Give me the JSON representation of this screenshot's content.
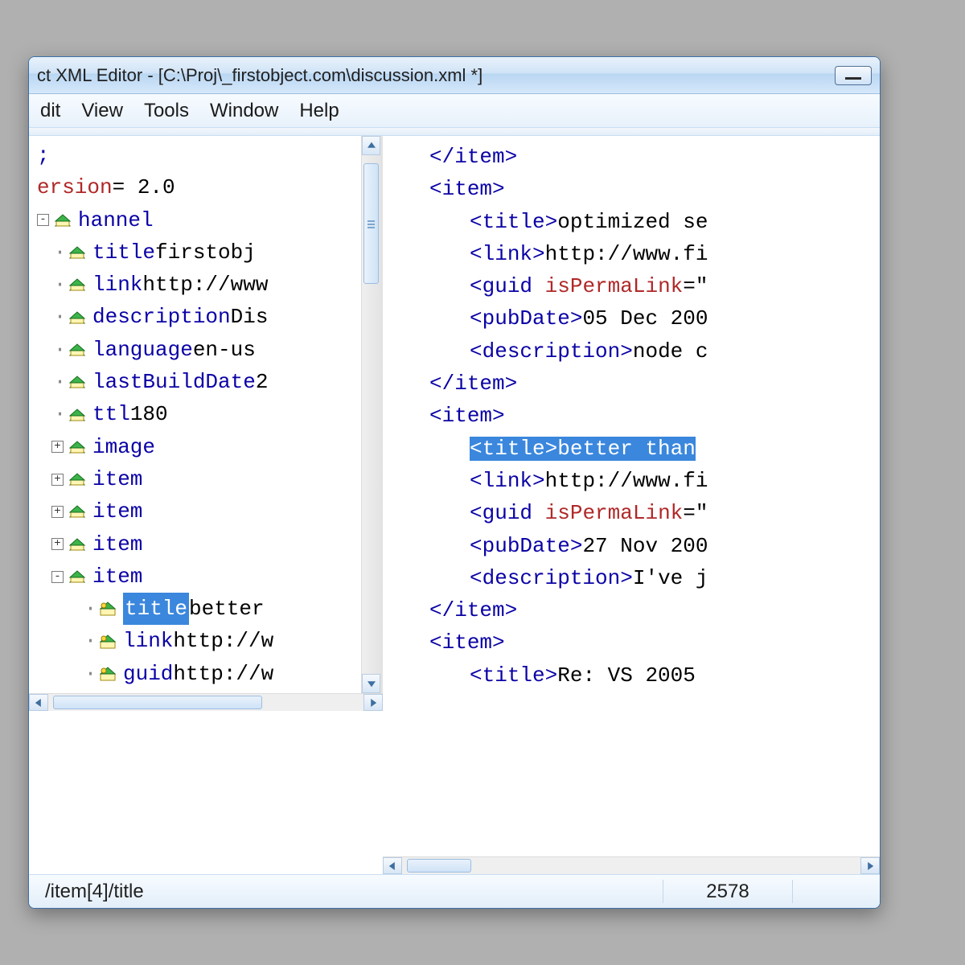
{
  "window": {
    "title_prefix": "ct XML Editor - [",
    "title_path": "C:\\Proj\\_firstobject.com\\discussion.xml *",
    "title_suffix": "]"
  },
  "menubar": [
    "dit",
    "View",
    "Tools",
    "Window",
    "Help"
  ],
  "tree": [
    {
      "indent": 1,
      "plus": "",
      "icon": "",
      "name": "",
      "value": "",
      "selected": false,
      "raw": ";"
    },
    {
      "indent": 1,
      "plus": "",
      "icon": "",
      "name": "ersion",
      "value": "= 2.0",
      "selected": false,
      "attr": true
    },
    {
      "indent": 1,
      "plus": "-",
      "icon": "elem",
      "name": "hannel",
      "value": "",
      "selected": false
    },
    {
      "indent": 2,
      "plus": "·",
      "icon": "elem",
      "name": "title",
      "value": "firstobj",
      "selected": false
    },
    {
      "indent": 2,
      "plus": "·",
      "icon": "elem",
      "name": "link",
      "value": "http://www",
      "selected": false
    },
    {
      "indent": 2,
      "plus": "·",
      "icon": "elem",
      "name": "description",
      "value": "Dis",
      "selected": false
    },
    {
      "indent": 2,
      "plus": "·",
      "icon": "elem",
      "name": "language",
      "value": "en-us",
      "selected": false
    },
    {
      "indent": 2,
      "plus": "·",
      "icon": "elem",
      "name": "lastBuildDate",
      "value": "2",
      "selected": false
    },
    {
      "indent": 2,
      "plus": "·",
      "icon": "elem",
      "name": "ttl",
      "value": "180",
      "selected": false
    },
    {
      "indent": 2,
      "plus": "+",
      "icon": "elem",
      "name": "image",
      "value": "",
      "selected": false
    },
    {
      "indent": 2,
      "plus": "+",
      "icon": "elem",
      "name": "item",
      "value": "",
      "selected": false
    },
    {
      "indent": 2,
      "plus": "+",
      "icon": "elem",
      "name": "item",
      "value": "",
      "selected": false
    },
    {
      "indent": 2,
      "plus": "+",
      "icon": "elem",
      "name": "item",
      "value": "",
      "selected": false
    },
    {
      "indent": 2,
      "plus": "-",
      "icon": "elem",
      "name": "item",
      "value": "",
      "selected": false
    },
    {
      "indent": 3,
      "plus": "·",
      "icon": "elem-attr",
      "name": "title",
      "value": "better",
      "selected": true
    },
    {
      "indent": 3,
      "plus": "·",
      "icon": "elem-attr",
      "name": "link",
      "value": "http://w",
      "selected": false
    },
    {
      "indent": 3,
      "plus": "·",
      "icon": "elem-attr",
      "name": "guid",
      "value": "http://w",
      "selected": false
    }
  ],
  "code": [
    {
      "pad": 1,
      "segments": [
        {
          "t": "ang",
          "v": "</"
        },
        {
          "t": "tag",
          "v": "item"
        },
        {
          "t": "ang",
          "v": ">"
        }
      ]
    },
    {
      "pad": 1,
      "segments": [
        {
          "t": "ang",
          "v": "<"
        },
        {
          "t": "tag",
          "v": "item"
        },
        {
          "t": "ang",
          "v": ">"
        }
      ]
    },
    {
      "pad": 2,
      "segments": [
        {
          "t": "ang",
          "v": "<"
        },
        {
          "t": "tag",
          "v": "title"
        },
        {
          "t": "ang",
          "v": ">"
        },
        {
          "t": "txt",
          "v": "optimized se"
        }
      ]
    },
    {
      "pad": 2,
      "segments": [
        {
          "t": "ang",
          "v": "<"
        },
        {
          "t": "tag",
          "v": "link"
        },
        {
          "t": "ang",
          "v": ">"
        },
        {
          "t": "txt",
          "v": "http://www.fi"
        }
      ]
    },
    {
      "pad": 2,
      "segments": [
        {
          "t": "ang",
          "v": "<"
        },
        {
          "t": "tag",
          "v": "guid"
        },
        {
          "t": "txt",
          "v": " "
        },
        {
          "t": "attr",
          "v": "isPermaLink"
        },
        {
          "t": "txt",
          "v": "=\""
        }
      ]
    },
    {
      "pad": 2,
      "segments": [
        {
          "t": "ang",
          "v": "<"
        },
        {
          "t": "tag",
          "v": "pubDate"
        },
        {
          "t": "ang",
          "v": ">"
        },
        {
          "t": "txt",
          "v": "05 Dec 200"
        }
      ]
    },
    {
      "pad": 2,
      "segments": [
        {
          "t": "ang",
          "v": "<"
        },
        {
          "t": "tag",
          "v": "description"
        },
        {
          "t": "ang",
          "v": ">"
        },
        {
          "t": "txt",
          "v": "node c"
        }
      ]
    },
    {
      "pad": 1,
      "segments": [
        {
          "t": "ang",
          "v": "</"
        },
        {
          "t": "tag",
          "v": "item"
        },
        {
          "t": "ang",
          "v": ">"
        }
      ]
    },
    {
      "pad": 1,
      "segments": [
        {
          "t": "ang",
          "v": "<"
        },
        {
          "t": "tag",
          "v": "item"
        },
        {
          "t": "ang",
          "v": ">"
        }
      ]
    },
    {
      "pad": 2,
      "selected": true,
      "segments": [
        {
          "t": "ang",
          "v": "<"
        },
        {
          "t": "tag",
          "v": "title"
        },
        {
          "t": "ang",
          "v": ">"
        },
        {
          "t": "txt",
          "v": "better than "
        }
      ]
    },
    {
      "pad": 2,
      "segments": [
        {
          "t": "ang",
          "v": "<"
        },
        {
          "t": "tag",
          "v": "link"
        },
        {
          "t": "ang",
          "v": ">"
        },
        {
          "t": "txt",
          "v": "http://www.fi"
        }
      ]
    },
    {
      "pad": 2,
      "segments": [
        {
          "t": "ang",
          "v": "<"
        },
        {
          "t": "tag",
          "v": "guid"
        },
        {
          "t": "txt",
          "v": " "
        },
        {
          "t": "attr",
          "v": "isPermaLink"
        },
        {
          "t": "txt",
          "v": "=\""
        }
      ]
    },
    {
      "pad": 2,
      "segments": [
        {
          "t": "ang",
          "v": "<"
        },
        {
          "t": "tag",
          "v": "pubDate"
        },
        {
          "t": "ang",
          "v": ">"
        },
        {
          "t": "txt",
          "v": "27 Nov 200"
        }
      ]
    },
    {
      "pad": 2,
      "segments": [
        {
          "t": "ang",
          "v": "<"
        },
        {
          "t": "tag",
          "v": "description"
        },
        {
          "t": "ang",
          "v": ">"
        },
        {
          "t": "txt",
          "v": "I've j"
        }
      ]
    },
    {
      "pad": 1,
      "segments": [
        {
          "t": "ang",
          "v": "</"
        },
        {
          "t": "tag",
          "v": "item"
        },
        {
          "t": "ang",
          "v": ">"
        }
      ]
    },
    {
      "pad": 1,
      "segments": [
        {
          "t": "ang",
          "v": "<"
        },
        {
          "t": "tag",
          "v": "item"
        },
        {
          "t": "ang",
          "v": ">"
        }
      ]
    },
    {
      "pad": 2,
      "segments": [
        {
          "t": "ang",
          "v": "<"
        },
        {
          "t": "tag",
          "v": "title"
        },
        {
          "t": "ang",
          "v": ">"
        },
        {
          "t": "txt",
          "v": "Re: VS 2005 "
        }
      ]
    }
  ],
  "status": {
    "path": "/item[4]/title",
    "position": "2578"
  }
}
